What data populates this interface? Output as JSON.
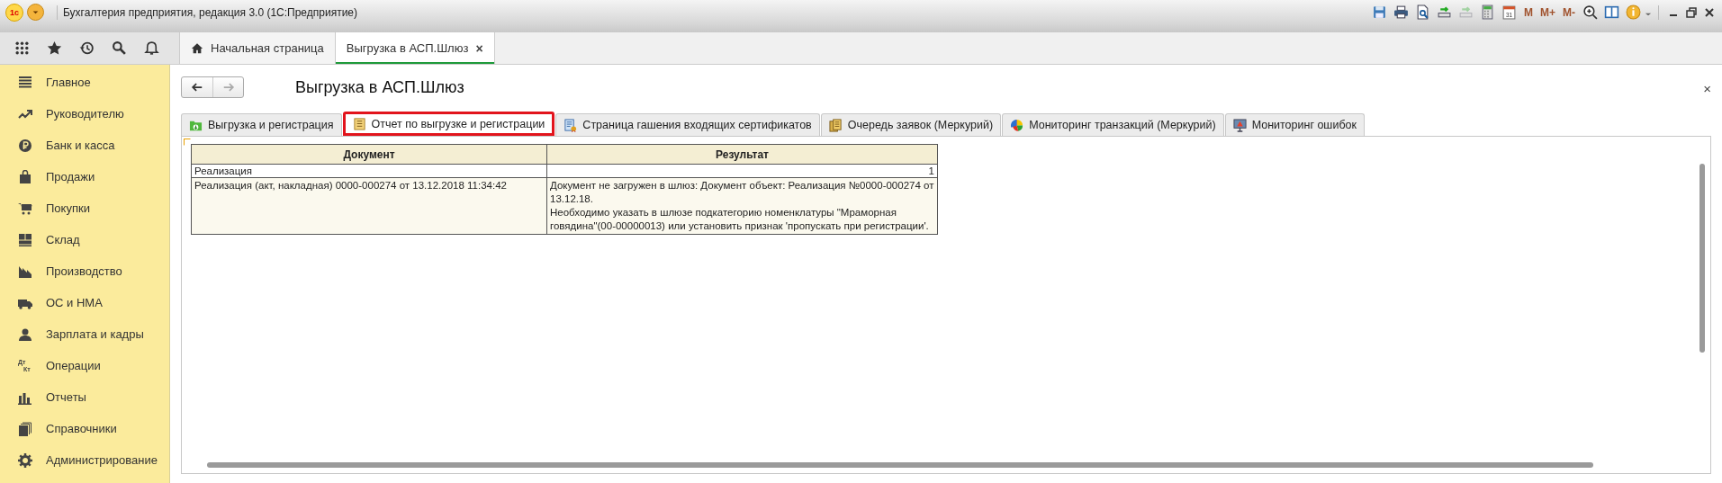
{
  "window": {
    "logo": "1с",
    "title": "Бухгалтерия предприятия, редакция 3.0  (1С:Предприятие)"
  },
  "toolbar": [
    {
      "kind": "save"
    },
    {
      "kind": "print"
    },
    {
      "kind": "preview"
    },
    {
      "kind": "transfer",
      "disabled": false
    },
    {
      "kind": "transfer",
      "disabled": true
    },
    {
      "kind": "calculator"
    },
    {
      "kind": "calendar",
      "label": "31"
    },
    {
      "kind": "memory",
      "label": "M"
    },
    {
      "kind": "memory",
      "label": "M+"
    },
    {
      "kind": "memory",
      "label": "M-"
    },
    {
      "kind": "zoom"
    },
    {
      "kind": "panels"
    },
    {
      "kind": "info"
    }
  ],
  "open_tabs": [
    {
      "kind": "home",
      "label": "Начальная страница",
      "selected": false
    },
    {
      "kind": "form",
      "label": "Выгрузка в АСП.Шлюз",
      "selected": true,
      "close": "×"
    }
  ],
  "sidebar": {
    "items": [
      {
        "kind": "main",
        "label": "Главное",
        "selected": false
      },
      {
        "kind": "trend",
        "label": "Руководителю",
        "selected": false
      },
      {
        "kind": "ruble",
        "label": "Банк и касса",
        "selected": false
      },
      {
        "kind": "bag",
        "label": "Продажи",
        "selected": false
      },
      {
        "kind": "cart",
        "label": "Покупки",
        "selected": false
      },
      {
        "kind": "grid",
        "label": "Склад",
        "selected": false
      },
      {
        "kind": "factory",
        "label": "Производство",
        "selected": false
      },
      {
        "kind": "truck",
        "label": "ОС и НМА",
        "selected": false
      },
      {
        "kind": "person",
        "label": "Зарплата и кадры",
        "selected": false
      },
      {
        "kind": "dtkt",
        "label": "Операции",
        "selected": false,
        "icon_text": [
          "Дт",
          "Кт"
        ]
      },
      {
        "kind": "bars",
        "label": "Отчеты",
        "selected": false
      },
      {
        "kind": "books",
        "label": "Справочники",
        "selected": false
      },
      {
        "kind": "gear",
        "label": "Администрирование",
        "selected": false
      }
    ]
  },
  "form": {
    "title": "Выгрузка в АСП.Шлюз",
    "back_disabled": false,
    "forward_disabled": true,
    "close": "×",
    "tabs": [
      {
        "kind": "upload",
        "label": "Выгрузка и регистрация",
        "selected": false
      },
      {
        "kind": "report",
        "label": "Отчет по выгрузке и регистрации",
        "selected": true
      },
      {
        "kind": "certificate",
        "label": "Страница гашения входящих сертификатов",
        "selected": false
      },
      {
        "kind": "queue",
        "label": "Очередь заявок (Меркурий)",
        "selected": false
      },
      {
        "kind": "pie",
        "label": "Мониторинг транзакций (Меркурий)",
        "selected": false
      },
      {
        "kind": "monitor",
        "label": "Мониторинг ошибок",
        "selected": false
      }
    ],
    "table": {
      "columns": [
        "Документ",
        "Результат"
      ],
      "rows": [
        {
          "kind": "group",
          "cells": [
            "Реализация",
            "1"
          ]
        },
        {
          "kind": "detail",
          "cells": [
            "Реализация (акт, накладная) 0000-000274 от 13.12.2018 11:34:42",
            "Документ не загружен в шлюз: Документ объект: Реализация №0000-000274 от 13.12.18.\nНеобходимо указать в шлюзе подкатегорию номенклатуры \"Мраморная говядина\"(00-00000013) или установить признак 'пропускать при регистрации'."
          ]
        }
      ]
    }
  }
}
